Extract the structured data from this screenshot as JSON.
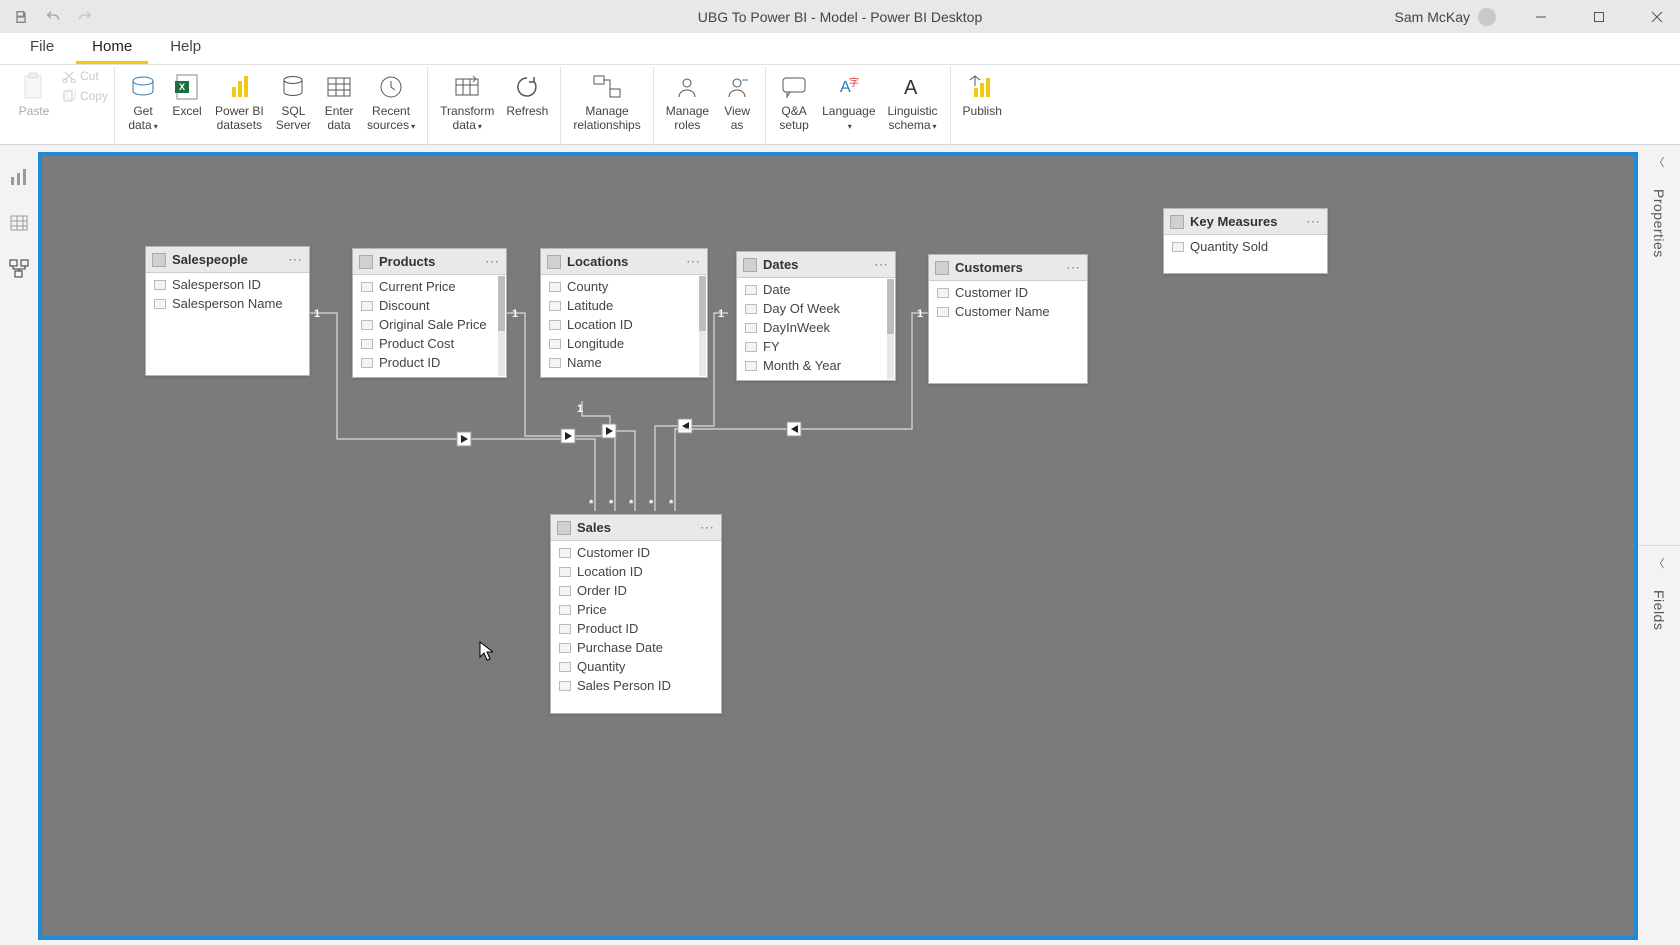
{
  "titlebar": {
    "title": "UBG To Power BI - Model - Power BI Desktop",
    "user": "Sam McKay"
  },
  "menu": {
    "file": "File",
    "home": "Home",
    "help": "Help"
  },
  "ribbon": {
    "paste": "Paste",
    "cut": "Cut",
    "copy": "Copy",
    "get_data": "Get\ndata",
    "excel": "Excel",
    "pbi_ds": "Power BI\ndatasets",
    "sql": "SQL\nServer",
    "enter": "Enter\ndata",
    "recent": "Recent\nsources",
    "transform": "Transform\ndata",
    "refresh": "Refresh",
    "manage_rel": "Manage\nrelationships",
    "manage_roles": "Manage\nroles",
    "view_as": "View\nas",
    "qa_setup": "Q&A\nsetup",
    "language": "Language",
    "ling": "Linguistic\nschema",
    "publish": "Publish"
  },
  "rightpanes": {
    "properties": "Properties",
    "fields": "Fields"
  },
  "tables": {
    "salespeople": {
      "name": "Salespeople",
      "fields": [
        "Salesperson ID",
        "Salesperson Name"
      ]
    },
    "products": {
      "name": "Products",
      "fields": [
        "Current Price",
        "Discount",
        "Original Sale Price",
        "Product Cost",
        "Product ID"
      ]
    },
    "locations": {
      "name": "Locations",
      "fields": [
        "County",
        "Latitude",
        "Location ID",
        "Longitude",
        "Name"
      ]
    },
    "dates": {
      "name": "Dates",
      "fields": [
        "Date",
        "Day Of Week",
        "DayInWeek",
        "FY",
        "Month & Year"
      ]
    },
    "customers": {
      "name": "Customers",
      "fields": [
        "Customer ID",
        "Customer Name"
      ]
    },
    "keymeasures": {
      "name": "Key Measures",
      "fields": [
        "Quantity Sold"
      ]
    },
    "sales": {
      "name": "Sales",
      "fields": [
        "Customer ID",
        "Location ID",
        "Order ID",
        "Price",
        "Product ID",
        "Purchase Date",
        "Quantity",
        "Sales Person ID"
      ]
    }
  }
}
